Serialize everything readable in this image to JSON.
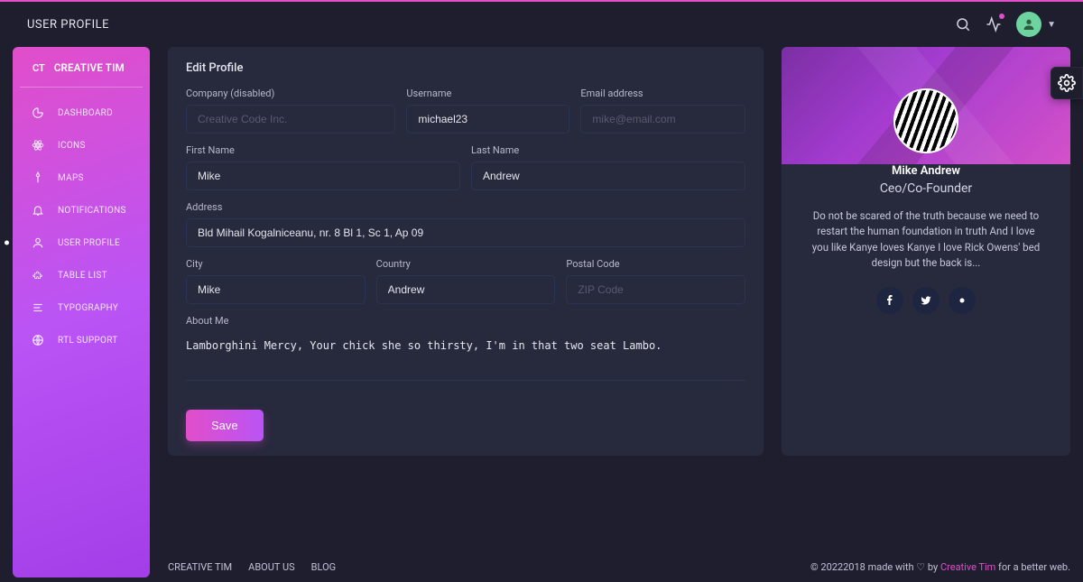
{
  "topbar": {
    "title": "USER PROFILE"
  },
  "sidebar": {
    "brand_badge": "CT",
    "brand_name": "CREATIVE TIM",
    "items": [
      {
        "label": "DASHBOARD"
      },
      {
        "label": "ICONS"
      },
      {
        "label": "MAPS"
      },
      {
        "label": "NOTIFICATIONS"
      },
      {
        "label": "USER PROFILE"
      },
      {
        "label": "TABLE LIST"
      },
      {
        "label": "TYPOGRAPHY"
      },
      {
        "label": "RTL SUPPORT"
      }
    ]
  },
  "form": {
    "title": "Edit Profile",
    "labels": {
      "company": "Company (disabled)",
      "username": "Username",
      "email": "Email address",
      "first_name": "First Name",
      "last_name": "Last Name",
      "address": "Address",
      "city": "City",
      "country": "Country",
      "postal": "Postal Code",
      "about": "About Me"
    },
    "values": {
      "company": "",
      "username": "michael23",
      "email": "",
      "first_name": "Mike",
      "last_name": "Andrew",
      "address": "Bld Mihail Kogalniceanu, nr. 8 Bl 1, Sc 1, Ap 09",
      "city": "Mike",
      "country": "Andrew",
      "postal": "",
      "about": "Lamborghini Mercy, Your chick she so thirsty, I'm in that two seat Lambo."
    },
    "placeholders": {
      "company": "Creative Code Inc.",
      "email": "mike@email.com",
      "postal": "ZIP Code"
    },
    "save_label": "Save"
  },
  "profile": {
    "name": "Mike Andrew",
    "role": "Ceo/Co-Founder",
    "bio": "Do not be scared of the truth because we need to restart the human foundation in truth And I love you like Kanye loves Kanye I love Rick Owens' bed design but the back is..."
  },
  "footer": {
    "links": [
      "CREATIVE TIM",
      "ABOUT US",
      "BLOG"
    ],
    "credit_prefix": "© 20222018 made with ",
    "credit_by": " by ",
    "credit_link": "Creative Tim",
    "credit_suffix": " for a better web."
  }
}
